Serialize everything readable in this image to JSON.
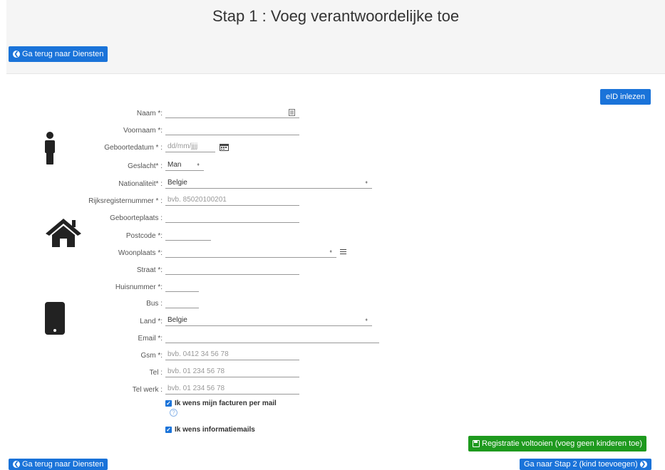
{
  "page": {
    "title": "Stap 1 : Voeg verantwoordelijke toe"
  },
  "nav": {
    "back_top": "Ga terug naar Diensten",
    "back_bottom": "Ga terug naar Diensten",
    "eid": "eID inlezen",
    "finish": "Registratie voltooien (voeg geen kinderen toe)",
    "next": "Ga naar Stap 2 (kind toevoegen)"
  },
  "form": {
    "naam": {
      "label": "Naam *:",
      "value": ""
    },
    "voornaam": {
      "label": "Voornaam *:",
      "value": ""
    },
    "geboortedatum": {
      "label": "Geboortedatum * :",
      "placeholder": "dd/mm/jjjj"
    },
    "geslacht": {
      "label": "Geslacht* :",
      "value": "Man"
    },
    "nationaliteit": {
      "label": "Nationaliteit* :",
      "value": "Belgie"
    },
    "rijksregister": {
      "label": "Rijksregisternummer * :",
      "placeholder": "bvb. 85020100201"
    },
    "geboorteplaats": {
      "label": "Geboorteplaats :",
      "value": ""
    },
    "postcode": {
      "label": "Postcode *:",
      "value": ""
    },
    "woonplaats": {
      "label": "Woonplaats *:",
      "value": ""
    },
    "straat": {
      "label": "Straat *:",
      "value": ""
    },
    "huisnummer": {
      "label": "Huisnummer *:",
      "value": ""
    },
    "bus": {
      "label": "Bus :",
      "value": ""
    },
    "land": {
      "label": "Land *:",
      "value": "Belgie"
    },
    "email": {
      "label": "Email *:",
      "value": ""
    },
    "gsm": {
      "label": "Gsm *:",
      "placeholder": "bvb. 0412 34 56 78"
    },
    "tel": {
      "label": "Tel :",
      "placeholder": "bvb. 01 234 56 78"
    },
    "telwerk": {
      "label": "Tel werk :",
      "placeholder": "bvb. 01 234 56 78"
    }
  },
  "checkboxes": {
    "facturen": {
      "label": "Ik wens mijn facturen per mail",
      "checked": true
    },
    "informatie": {
      "label": "Ik wens informatiemails",
      "checked": true
    }
  },
  "icons": {
    "person": "person-icon",
    "home": "home-icon",
    "phone": "mobile-phone-icon",
    "calendar": "calendar-icon",
    "contact": "contact-card-icon",
    "list": "list-icon",
    "help": "question-circle-icon",
    "back": "arrow-circle-left-icon",
    "forward": "arrow-circle-right-icon",
    "save": "save-icon"
  },
  "colors": {
    "primary": "#1a73d9",
    "success": "#1e9a1e",
    "header_bg": "#f5f5f5"
  }
}
